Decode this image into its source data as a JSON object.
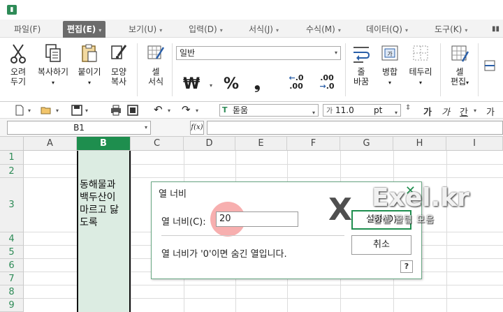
{
  "menu": {
    "tabs": [
      {
        "label": "파일(F)"
      },
      {
        "label": "편집(E)"
      },
      {
        "label": "보기(U)"
      },
      {
        "label": "입력(D)"
      },
      {
        "label": "서식(J)"
      },
      {
        "label": "수식(M)"
      },
      {
        "label": "데이터(Q)"
      },
      {
        "label": "도구(K)"
      }
    ],
    "active_tab": "편집(E)"
  },
  "ribbon": {
    "cut": "오려\n두기",
    "cut_l1": "오려",
    "cut_l2": "두기",
    "copy": "복사하기",
    "paste": "붙이기",
    "format_painter_l1": "모양",
    "format_painter_l2": "복사",
    "cell_format_l1": "셀",
    "cell_format_l2": "서식",
    "number_format": "일반",
    "currency_symbol": "₩",
    "percent_symbol": "%",
    "comma_symbol": "❟",
    "dec_increase": ".0\n.00",
    "wrap_l1": "줄",
    "wrap_l2": "바꿈",
    "merge": "병합",
    "borders": "테두리",
    "cell_edit_l1": "셀",
    "cell_edit_l2": "편집"
  },
  "font_bar": {
    "font_name": "돋움",
    "font_size": "11.0",
    "font_unit": "pt",
    "bold": "가",
    "italic": "가",
    "underline": "간",
    "more": "가"
  },
  "formula_bar": {
    "cell_ref": "B1",
    "fx": "f(x)",
    "value": ""
  },
  "grid": {
    "columns": [
      "A",
      "B",
      "C",
      "D",
      "E",
      "F",
      "G",
      "H",
      "I"
    ],
    "selected_column": "B",
    "rows": [
      "1",
      "2",
      "3",
      "4",
      "5",
      "6",
      "7",
      "8",
      "9"
    ],
    "cell_b3": [
      "동해물과",
      "백두산이",
      "마르고 닳",
      "도록"
    ]
  },
  "dialog": {
    "title": "열 너비",
    "label": "열 너비(C):",
    "value": "20",
    "note": "열 너비가 '0'이면 숨긴 열입니다.",
    "ok": "설정(D)",
    "cancel": "취소",
    "help": "?"
  },
  "watermark": {
    "mark": "X",
    "brand": "Exel.kr",
    "tagline": "한셀 꿀팁 모음"
  },
  "colors": {
    "accent": "#1e8e4e",
    "selected_column_fill": "#dcece2",
    "highlight": "#f06e6e"
  }
}
